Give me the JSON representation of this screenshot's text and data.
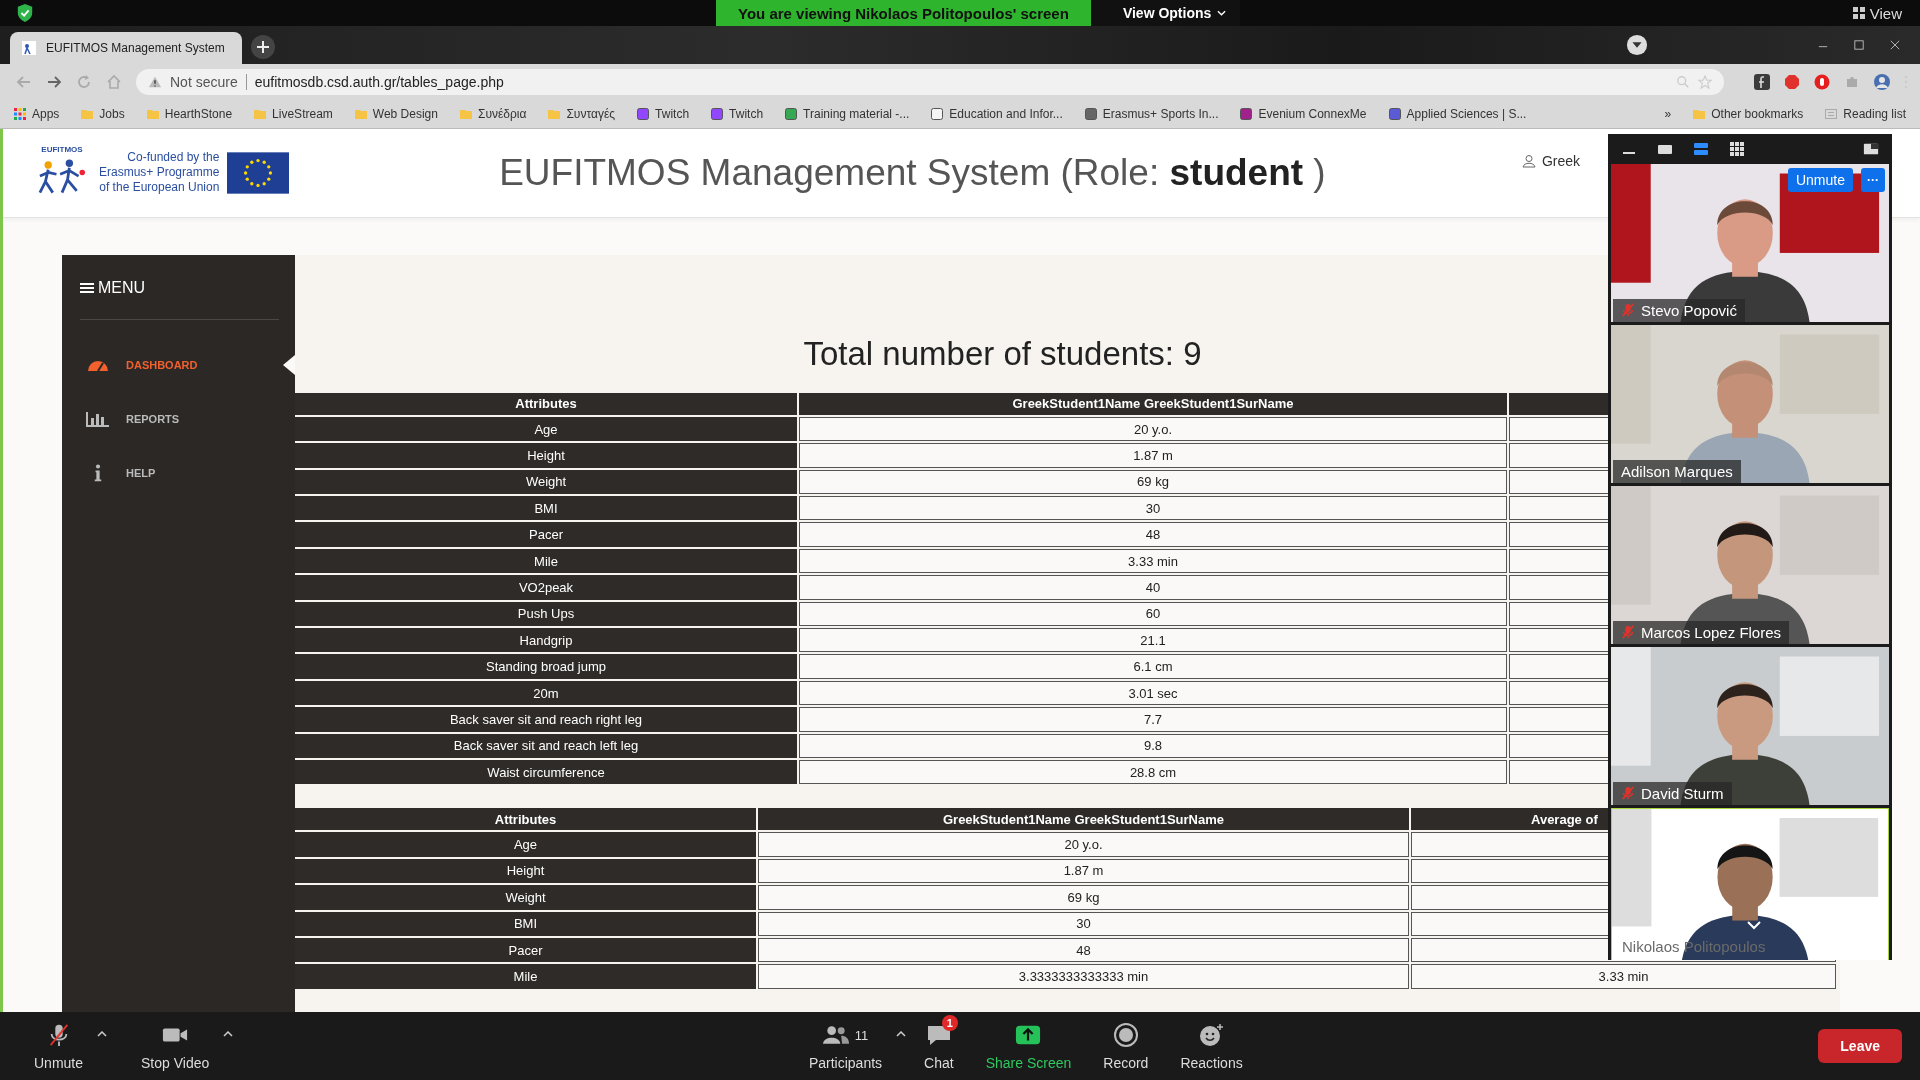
{
  "zoom_banner": {
    "text": "You are viewing Nikolaos Politopoulos' screen",
    "view_options": "View Options",
    "view": "View"
  },
  "browser": {
    "tabs": [
      {
        "title": "EUFITMOS Management System",
        "selected": true
      }
    ],
    "security": "Not secure",
    "url": "eufitmosdb.csd.auth.gr/tables_page.php",
    "bookmarks": [
      {
        "label": "Apps",
        "kind": "apps"
      },
      {
        "label": "Jobs",
        "kind": "folder"
      },
      {
        "label": "HearthStone",
        "kind": "folder"
      },
      {
        "label": "LiveStream",
        "kind": "folder"
      },
      {
        "label": "Web Design",
        "kind": "folder"
      },
      {
        "label": "Συνέδρια",
        "kind": "folder"
      },
      {
        "label": "Συνταγές",
        "kind": "folder"
      },
      {
        "label": "Twitch",
        "kind": "site",
        "color": "#9146ff"
      },
      {
        "label": "Twitch",
        "kind": "site",
        "color": "#9146ff"
      },
      {
        "label": "Training material -...",
        "kind": "site",
        "color": "#34a853"
      },
      {
        "label": "Education and Infor...",
        "kind": "site",
        "color": "#f4f4f4"
      },
      {
        "label": "Erasmus+ Sports In...",
        "kind": "site",
        "color": "#666666"
      },
      {
        "label": "Evenium ConnexMe",
        "kind": "site",
        "color": "#a0208c"
      },
      {
        "label": "Applied Sciences | S...",
        "kind": "site",
        "color": "#5b5bd6"
      }
    ],
    "more": "»",
    "other_bookmarks": "Other bookmarks",
    "reading_list": "Reading list"
  },
  "header": {
    "logo_text": "EUFITMOS",
    "cofunded": [
      "Co-funded by the",
      "Erasmus+ Programme",
      "of the European Union"
    ],
    "title": "EUFITMOS Management System (Role: **student** )",
    "user": "Greek"
  },
  "sidebar": {
    "menu": "MENU",
    "items": [
      {
        "label": "DASHBOARD",
        "kind": "dashboard",
        "selected": true
      },
      {
        "label": "REPORTS",
        "kind": "reports",
        "selected": false
      },
      {
        "label": "HELP",
        "kind": "help",
        "selected": false
      }
    ]
  },
  "content": {
    "heading": "Total number of students: 9",
    "tables": [
      {
        "columns": [
          "Attributes",
          "GreekStudent1Name GreekStudent1SurName"
        ],
        "rows": [
          [
            "Age",
            "20 y.o."
          ],
          [
            "Height",
            "1.87 m"
          ],
          [
            "Weight",
            "69 kg"
          ],
          [
            "BMI",
            "30"
          ],
          [
            "Pacer",
            "48"
          ],
          [
            "Mile",
            "3.33 min"
          ],
          [
            "VO2peak",
            "40"
          ],
          [
            "Push Ups",
            "60"
          ],
          [
            "Handgrip",
            "21.1"
          ],
          [
            "Standing broad jump",
            "6.1 cm"
          ],
          [
            "20m",
            "3.01 sec"
          ],
          [
            "Back saver sit and reach right leg",
            "7.7"
          ],
          [
            "Back saver sit and reach left leg",
            "9.8"
          ],
          [
            "Waist circumference",
            "28.8 cm"
          ]
        ]
      },
      {
        "columns": [
          "Attributes",
          "GreekStudent1Name GreekStudent1SurName",
          "Average of"
        ],
        "rows": [
          [
            "Age",
            "20 y.o."
          ],
          [
            "Height",
            "1.87 m"
          ],
          [
            "Weight",
            "69 kg"
          ],
          [
            "BMI",
            "30"
          ],
          [
            "Pacer",
            "48"
          ],
          [
            "Mile",
            "3.3333333333333 min",
            "3.33 min"
          ]
        ]
      }
    ]
  },
  "video_panel": {
    "unmute": "Unmute",
    "more": "···",
    "tiles": [
      {
        "name": "Stevo Popović",
        "muted": true
      },
      {
        "name": "Adilson Marques",
        "muted": false
      },
      {
        "name": "Marcos Lopez Flores",
        "muted": true
      },
      {
        "name": "David Sturm",
        "muted": true
      },
      {
        "name": "Nikolaos Politopoulos",
        "muted": false
      }
    ]
  },
  "toolbar": {
    "items": [
      {
        "label": "Unmute",
        "kind": "mic",
        "caret": true
      },
      {
        "label": "Stop Video",
        "kind": "video",
        "caret": true
      },
      {
        "label": "Participants",
        "kind": "participants",
        "count": "11",
        "caret": true
      },
      {
        "label": "Chat",
        "kind": "chat",
        "badge": "1",
        "caret": false
      },
      {
        "label": "Share Screen",
        "kind": "share",
        "caret": false
      },
      {
        "label": "Record",
        "kind": "record",
        "caret": false
      },
      {
        "label": "Reactions",
        "kind": "reactions",
        "caret": false
      }
    ],
    "leave": "Leave"
  }
}
